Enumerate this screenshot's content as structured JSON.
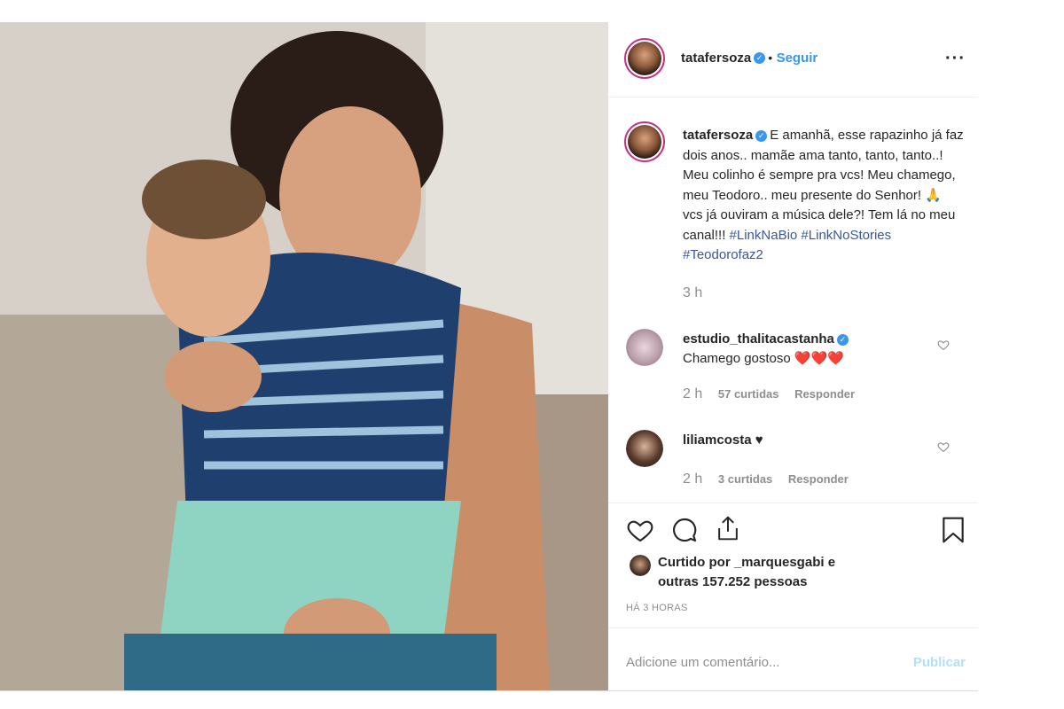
{
  "post": {
    "author": {
      "username": "tatafersoza",
      "verified_icon": "verified-badge-icon",
      "separator": "•",
      "follow_label": "Seguir",
      "more_label": "···"
    },
    "caption": {
      "username": "tatafersoza",
      "text": "E amanhã, esse rapazinho já faz dois anos.. mamãe ama tanto, tanto, tanto..! Meu colinho é sempre pra vcs! Meu chamego, meu Teodoro.. meu presente do Senhor! 🙏 vcs já ouviram a música dele?! Tem lá no meu canal!!! ",
      "hashtags": [
        "#LinkNaBio",
        "#LinkNoStories",
        "#Teodorofaz2"
      ],
      "time": "3 h"
    },
    "comments": [
      {
        "username": "estudio_thalitacastanha",
        "verified": true,
        "text": "Chamego gostoso ❤️❤️❤️",
        "time": "2 h",
        "likes": "57 curtidas",
        "reply": "Responder"
      },
      {
        "username": "liliamcosta",
        "suffix": "♥",
        "text": "",
        "time": "2 h",
        "likes": "3 curtidas",
        "reply": "Responder"
      }
    ],
    "likes_text_line1": "Curtido por _marquesgabi e",
    "likes_text_line2": "outras 157.252 pessoas",
    "timestamp": "HÁ 3 HORAS",
    "add_comment_placeholder": "Adicione um comentário...",
    "publish_label": "Publicar"
  },
  "colors": {
    "accent": "#3897f0",
    "hashtag": "#385898",
    "heart": "#ed2939",
    "muted": "#8e8e8e"
  },
  "icons": [
    "like-heart-icon",
    "comment-bubble-icon",
    "share-icon",
    "save-bookmark-icon",
    "comment-like-heart-icon"
  ]
}
